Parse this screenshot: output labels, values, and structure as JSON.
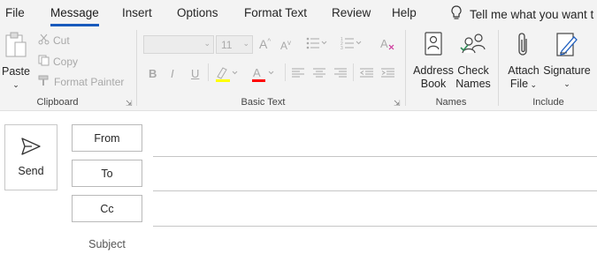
{
  "tabs": [
    "File",
    "Message",
    "Insert",
    "Options",
    "Format Text",
    "Review",
    "Help"
  ],
  "tell_me": "Tell me what you want t",
  "clipboard": {
    "paste": "Paste",
    "cut": "Cut",
    "copy": "Copy",
    "format_painter": "Format Painter",
    "group": "Clipboard"
  },
  "basic_text": {
    "font_size": "11",
    "bold": "B",
    "italic": "I",
    "underline": "U",
    "grow": "A",
    "shrink": "A",
    "group": "Basic Text"
  },
  "names": {
    "address_book": [
      "Address",
      "Book"
    ],
    "check_names": [
      "Check",
      "Names"
    ],
    "group": "Names"
  },
  "include": {
    "attach": [
      "Attach",
      "File"
    ],
    "signature": "Signature",
    "group": "Include"
  },
  "compose": {
    "send": "Send",
    "from": "From",
    "to": "To",
    "cc": "Cc",
    "subject": "Subject"
  },
  "colors": {
    "accent": "#185abd",
    "ribbon_bg": "#f3f3f3",
    "disabled": "#a8a8a8",
    "highlighter": "#ffff00",
    "font_color": "#ff0000"
  }
}
